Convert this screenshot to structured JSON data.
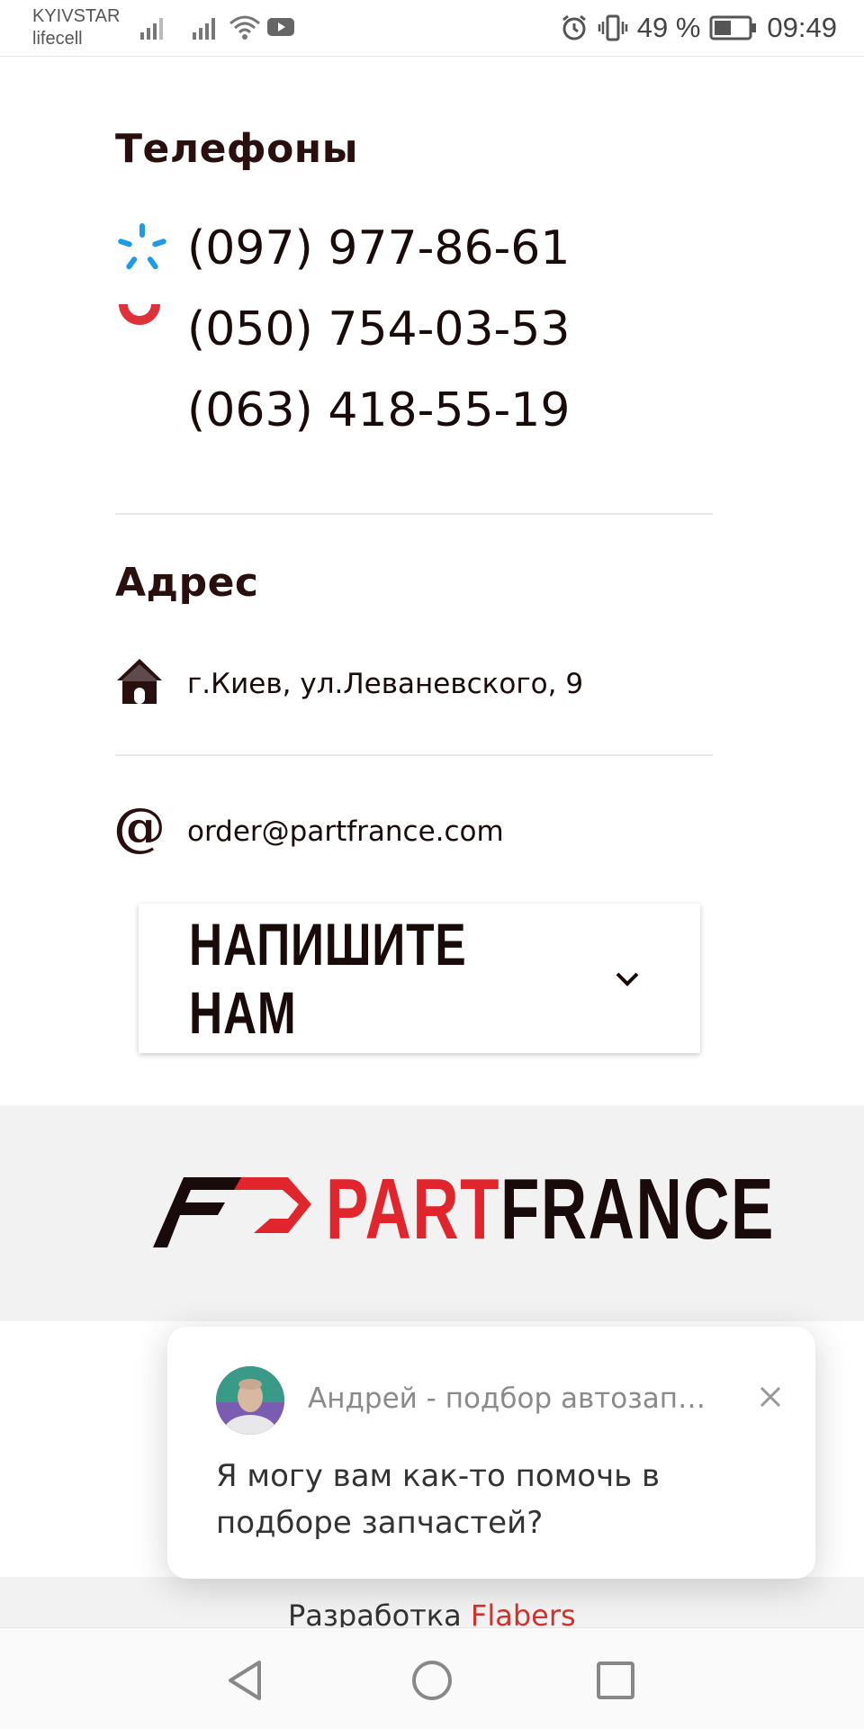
{
  "status_bar": {
    "carrier_1": "KYIVSTAR",
    "carrier_2": "lifecell",
    "battery": "49 %",
    "time": "09:49"
  },
  "contacts": {
    "phones_heading": "Телефоны",
    "phones": [
      {
        "number": "(097) 977-86-61",
        "operator_icon": "kyivstar-icon"
      },
      {
        "number": "(050) 754-03-53",
        "operator_icon": "vodafone-icon"
      },
      {
        "number": "(063) 418-55-19",
        "operator_icon": ""
      }
    ],
    "address_heading": "Адрес",
    "address": "г.Киев, ул.Леваневского, 9",
    "email": "order@partfrance.com"
  },
  "write_us": {
    "label": "НАПИШИТЕ НАМ"
  },
  "brand": {
    "part": "PART",
    "france": "FRANCE"
  },
  "footer": {
    "credits_label": "Разработка",
    "credits_link": "Flabers"
  },
  "chat_popup": {
    "agent_name": "Андрей - подбор автозапча...",
    "message": "Я могу вам как-то помочь в подборе запчастей?"
  },
  "colors": {
    "accent_red": "#e0262c",
    "kyivstar_blue": "#1e9be6",
    "text_dark": "#1a0b0b"
  }
}
